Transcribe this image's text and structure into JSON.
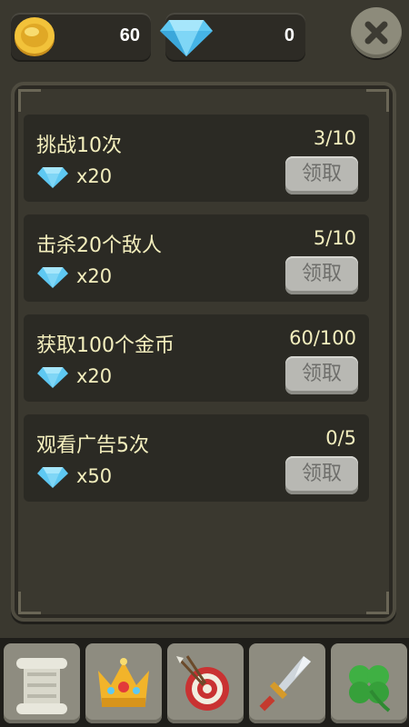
{
  "currency": {
    "gold": "60",
    "gems": "0",
    "gold_icon": "gold-coin-icon",
    "gem_icon": "diamond-icon"
  },
  "close_icon": "close-icon",
  "quests": [
    {
      "title": "挑战10次",
      "progress": "3/10",
      "reward": "x20",
      "reward_icon": "diamond-icon",
      "button": "领取"
    },
    {
      "title": "击杀20个敌人",
      "progress": "5/10",
      "reward": "x20",
      "reward_icon": "diamond-icon",
      "button": "领取"
    },
    {
      "title": "获取100个金币",
      "progress": "60/100",
      "reward": "x20",
      "reward_icon": "diamond-icon",
      "button": "领取"
    },
    {
      "title": "观看广告5次",
      "progress": "0/5",
      "reward": "x50",
      "reward_icon": "diamond-icon",
      "button": "领取"
    }
  ],
  "nav_tabs": [
    {
      "icon": "scroll-icon"
    },
    {
      "icon": "crown-icon"
    },
    {
      "icon": "target-arrows-icon"
    },
    {
      "icon": "sword-icon"
    },
    {
      "icon": "clover-icon"
    }
  ],
  "colors": {
    "background": "#3a382f",
    "text": "#f4efbe",
    "button": "#b8b8b3",
    "gem": "#5ec8f2",
    "gold": "#f2c23a"
  }
}
